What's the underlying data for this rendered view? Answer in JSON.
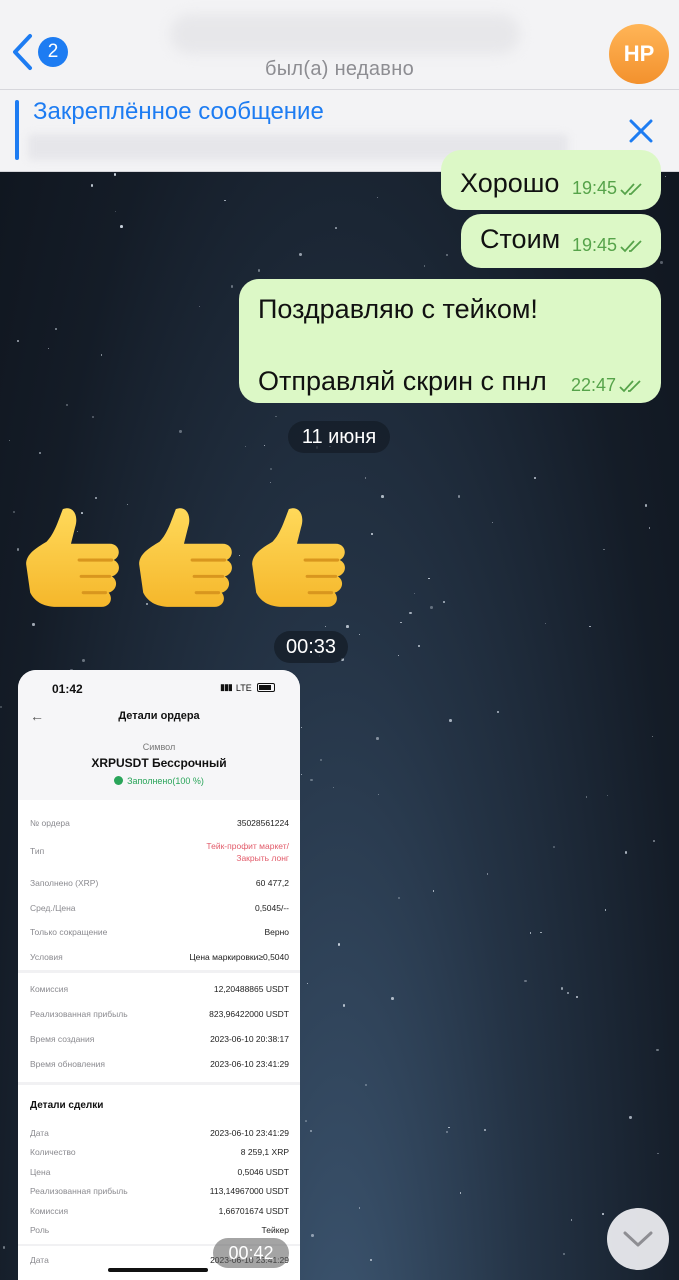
{
  "header": {
    "back_badge": "2",
    "status": "был(а) недавно",
    "avatar_initials": "НР"
  },
  "pinned": {
    "title": "Закреплённое сообщение"
  },
  "messages": [
    {
      "text": "Хорошо",
      "time": "19:45"
    },
    {
      "text": "Стоим",
      "time": "19:45"
    },
    {
      "text": "Поздравляю с тейком!\n\nОтправляй скрин с пнл",
      "time": "22:47"
    }
  ],
  "date_separator": "11 июня",
  "emoji_message": [
    "thumbs-up",
    "thumbs-up",
    "thumbs-up"
  ],
  "photo_time_label": "00:33",
  "order_screenshot": {
    "phone_time": "01:42",
    "network": "LTE",
    "title": "Детали ордера",
    "symbol_label": "Символ",
    "symbol": "XRPUSDT Бессрочный",
    "filled": "Заполнено(100 %)",
    "rows": [
      {
        "k": "№ ордера",
        "v": "35028561224"
      },
      {
        "k": "Тип",
        "v": "Тейк-профит маркет/\nЗакрыть лонг"
      },
      {
        "k": "Заполнено (XRP)",
        "v": "60 477,2"
      },
      {
        "k": "Сред./Цена",
        "v": "0,5045/--"
      },
      {
        "k": "Только сокращение",
        "v": "Верно"
      },
      {
        "k": "Условия",
        "v": "Цена маркировки≥0,5040"
      },
      {
        "k": "Комиссия",
        "v": "12,20488865 USDT"
      },
      {
        "k": "Реализованная прибыль",
        "v": "823,96422000 USDT"
      },
      {
        "k": "Время создания",
        "v": "2023-06-10 20:38:17"
      },
      {
        "k": "Время обновления",
        "v": "2023-06-10 23:41:29"
      }
    ],
    "deal_title": "Детали сделки",
    "deal_rows": [
      {
        "k": "Дата",
        "v": "2023-06-10 23:41:29"
      },
      {
        "k": "Количество",
        "v": "8 259,1 XRP"
      },
      {
        "k": "Цена",
        "v": "0,5046 USDT"
      },
      {
        "k": "Реализованная прибыль",
        "v": "113,14967000 USDT"
      },
      {
        "k": "Комиссия",
        "v": "1,66701674 USDT"
      },
      {
        "k": "Роль",
        "v": "Тейкер"
      },
      {
        "k": "Дата",
        "v": "2023-06-10 23:41:29"
      }
    ]
  },
  "video_time": "00:42",
  "colors": {
    "bubble_out": "#dcf8c6",
    "accent": "#1d7cf2",
    "time_green": "#56a34a"
  }
}
